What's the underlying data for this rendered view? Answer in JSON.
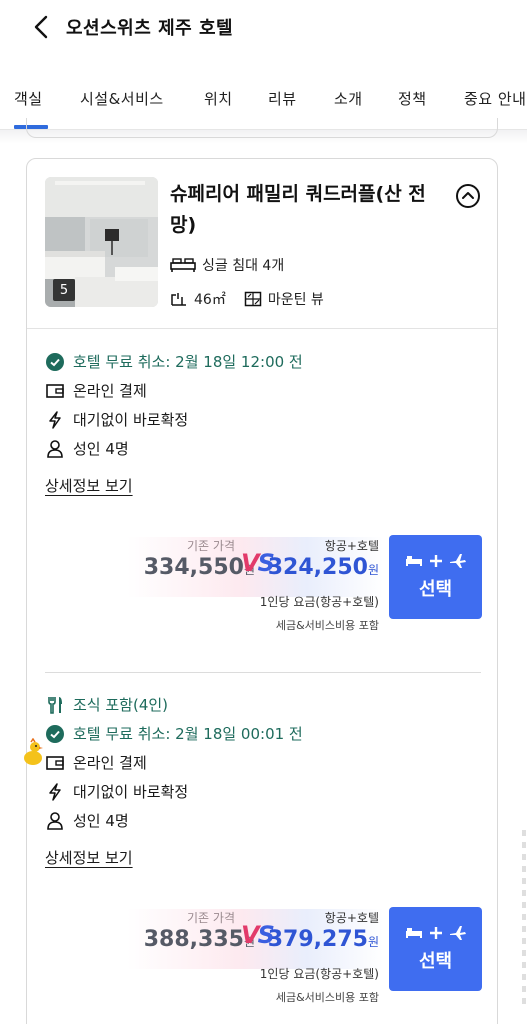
{
  "header": {
    "title": "오션스위츠 제주 호텔"
  },
  "tabs": [
    {
      "label": "객실",
      "active": true
    },
    {
      "label": "시설&서비스",
      "active": false
    },
    {
      "label": "위치",
      "active": false
    },
    {
      "label": "리뷰",
      "active": false
    },
    {
      "label": "소개",
      "active": false
    },
    {
      "label": "정책",
      "active": false
    },
    {
      "label": "중요 안내",
      "active": false
    }
  ],
  "room": {
    "name": "슈페리어 패밀리 쿼드러플(산 전망)",
    "photo_count": "5",
    "beds": "싱글 침대 4개",
    "size": "46㎡",
    "view": "마운틴 뷰"
  },
  "options": [
    {
      "features": [
        {
          "icon": "check-circle-icon",
          "text": "호텔 무료 취소: 2월 18일 12:00 전",
          "highlight": true
        },
        {
          "icon": "wallet-icon",
          "text": "온라인 결제",
          "highlight": false
        },
        {
          "icon": "lightning-icon",
          "text": "대기없이 바로확정",
          "highlight": false
        },
        {
          "icon": "person-icon",
          "text": "성인 4명",
          "highlight": false
        }
      ],
      "detail_link": "상세정보 보기",
      "original_label": "기존 가격",
      "original_price": "334,550",
      "package_label": "항공+호텔",
      "package_price": "324,250",
      "currency": "원",
      "per_person": "1인당 요금(항공+호텔)",
      "tax_note": "세금&서비스비용 포함",
      "button_label": "선택"
    },
    {
      "features": [
        {
          "icon": "utensils-icon",
          "text": "조식 포함(4인)",
          "highlight": true
        },
        {
          "icon": "check-circle-icon",
          "text": "호텔 무료 취소: 2월 18일 00:01 전",
          "highlight": true
        },
        {
          "icon": "wallet-icon",
          "text": "온라인 결제",
          "highlight": false
        },
        {
          "icon": "lightning-icon",
          "text": "대기없이 바로확정",
          "highlight": false
        },
        {
          "icon": "person-icon",
          "text": "성인 4명",
          "highlight": false
        }
      ],
      "detail_link": "상세정보 보기",
      "original_label": "기존 가격",
      "original_price": "388,335",
      "package_label": "항공+호텔",
      "package_price": "379,275",
      "currency": "원",
      "per_person": "1인당 요금(항공+호텔)",
      "tax_note": "세금&서비스비용 포함",
      "button_label": "선택"
    }
  ],
  "vs_text": {
    "v": "V",
    "s": "S"
  },
  "colors": {
    "accent": "#3f6df0",
    "green": "#1e6b5c",
    "package_price": "#2f55d4",
    "vs_red": "#e23a6a"
  }
}
